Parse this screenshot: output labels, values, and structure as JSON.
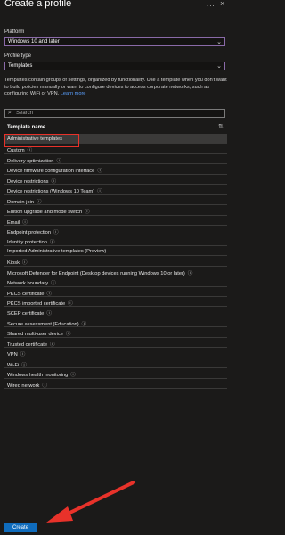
{
  "header": {
    "title": "Create a profile",
    "more": "...",
    "close": "×"
  },
  "platform": {
    "label": "Platform",
    "value": "Windows 10 and later"
  },
  "profile_type": {
    "label": "Profile type",
    "value": "Templates"
  },
  "description": {
    "text": "Templates contain groups of settings, organized by functionality. Use a template when you don't want to build policies manually or want to configure devices to access corporate networks, such as configuring WiFi or VPN.",
    "link": "Learn more"
  },
  "search": {
    "placeholder": "Search"
  },
  "table": {
    "column_header": "Template name",
    "rows": [
      {
        "label": "Administrative templates",
        "info": false,
        "selected": true
      },
      {
        "label": "Custom",
        "info": true
      },
      {
        "label": "Delivery optimization",
        "info": true
      },
      {
        "label": "Device firmware configuration interface",
        "info": true
      },
      {
        "label": "Device restrictions",
        "info": true
      },
      {
        "label": "Device restrictions (Windows 10 Team)",
        "info": true
      },
      {
        "label": "Domain join",
        "info": true
      },
      {
        "label": "Edition upgrade and mode switch",
        "info": true
      },
      {
        "label": "Email",
        "info": true
      },
      {
        "label": "Endpoint protection",
        "info": true
      },
      {
        "label": "Identity protection",
        "info": true
      },
      {
        "label": "Imported Administrative templates (Preview)",
        "info": false
      },
      {
        "label": "Kiosk",
        "info": true
      },
      {
        "label": "Microsoft Defender for Endpoint (Desktop devices running Windows 10 or later)",
        "info": true
      },
      {
        "label": "Network boundary",
        "info": true
      },
      {
        "label": "PKCS certificate",
        "info": true
      },
      {
        "label": "PKCS imported certificate",
        "info": true
      },
      {
        "label": "SCEP certificate",
        "info": true
      },
      {
        "label": "Secure assessment (Education)",
        "info": true
      },
      {
        "label": "Shared multi-user device",
        "info": true
      },
      {
        "label": "Trusted certificate",
        "info": true
      },
      {
        "label": "VPN",
        "info": true
      },
      {
        "label": "Wi-Fi",
        "info": true
      },
      {
        "label": "Windows health monitoring",
        "info": true
      },
      {
        "label": "Wired network",
        "info": true
      }
    ]
  },
  "footer": {
    "create_label": "Create"
  },
  "colors": {
    "highlight": "#e8322a",
    "accent": "#0f6cbd",
    "link": "#5aa0ff"
  }
}
